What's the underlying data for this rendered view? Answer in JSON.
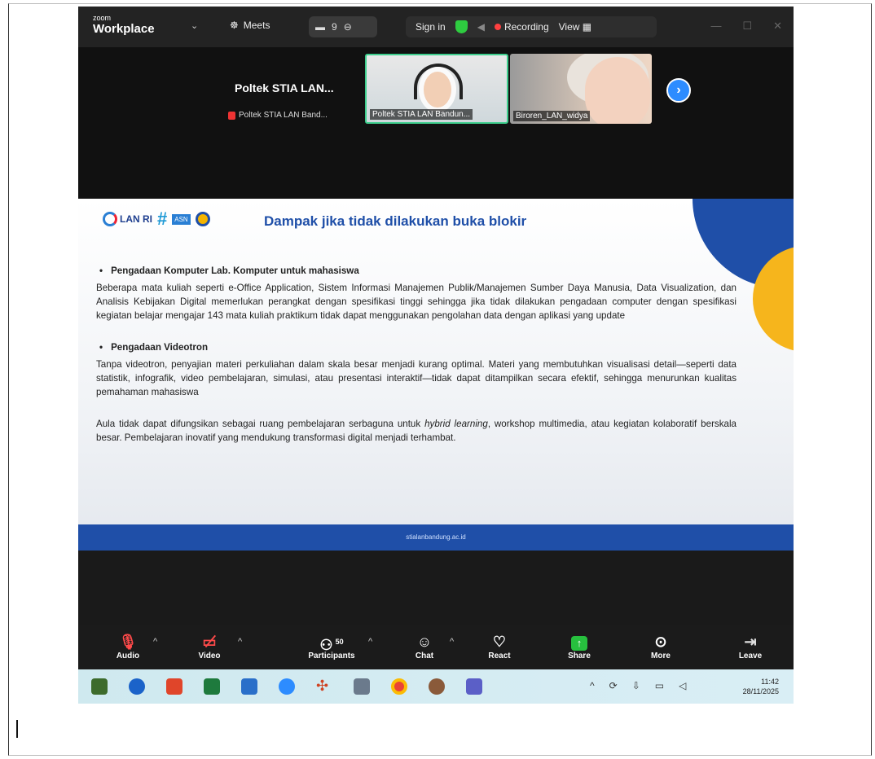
{
  "window": {
    "logo_small": "zoom",
    "logo_big": "Workplace",
    "dropdown": "⌄",
    "meets_label": "Meets",
    "chip_count": "9",
    "sign_in": "Sign in",
    "recording": "Recording",
    "view": "View"
  },
  "gallery": {
    "active_speaker": "Poltek STIA LAN...",
    "active_speaker_sub": "Poltek STIA LAN Band...",
    "tiles": [
      {
        "label": "Poltek STIA LAN Bandun..."
      },
      {
        "label": "Biroren_LAN_widya"
      }
    ]
  },
  "slide": {
    "title": "Dampak jika tidak dilakukan buka blokir",
    "logo_text": "LAN RI",
    "hash_text": "#",
    "asn_text": "ASN",
    "sections": [
      {
        "heading": "Pengadaan Komputer Lab. Komputer untuk mahasiswa",
        "body": "Beberapa mata kuliah seperti e-Office Application, Sistem Informasi Manajemen Publik/Manajemen Sumber Daya Manusia, Data Visualization, dan Analisis Kebijakan Digital memerlukan perangkat dengan spesifikasi tinggi sehingga jika tidak dilakukan pengadaan computer dengan spesifikasi kegiatan belajar mengajar 143 mata kuliah praktikum tidak dapat menggunakan pengolahan data dengan aplikasi yang update"
      },
      {
        "heading": "Pengadaan Videotron",
        "body": "Tanpa videotron, penyajian materi perkuliahan dalam skala besar menjadi kurang optimal. Materi yang membutuhkan visualisasi detail—seperti data statistik, infografik, video pembelajaran, simulasi, atau presentasi interaktif—tidak dapat ditampilkan secara efektif, sehingga menurunkan kualitas pemahaman mahasiswa"
      }
    ],
    "closing_pre": "Aula tidak dapat difungsikan sebagai ruang pembelajaran serbaguna untuk ",
    "closing_em": "hybrid learning",
    "closing_post": ", workshop multimedia, atau kegiatan kolaboratif berskala besar. Pembelajaran inovatif yang mendukung transformasi digital menjadi terhambat.",
    "footer": "stialanbandung.ac.id"
  },
  "toolbar": {
    "audio": "Audio",
    "video": "Video",
    "participants": "Participants",
    "participants_count": "50",
    "chat": "Chat",
    "react": "React",
    "share": "Share",
    "more": "More",
    "leave": "Leave"
  },
  "taskbar": {
    "time": "11:42",
    "date": "28/11/2025"
  },
  "colors": {
    "zoom_blue": "#2d8cff",
    "slide_blue": "#1f4fa8",
    "slide_yellow": "#f6b51c",
    "share_green": "#27c03e",
    "mute_red": "#ff4a4a"
  }
}
